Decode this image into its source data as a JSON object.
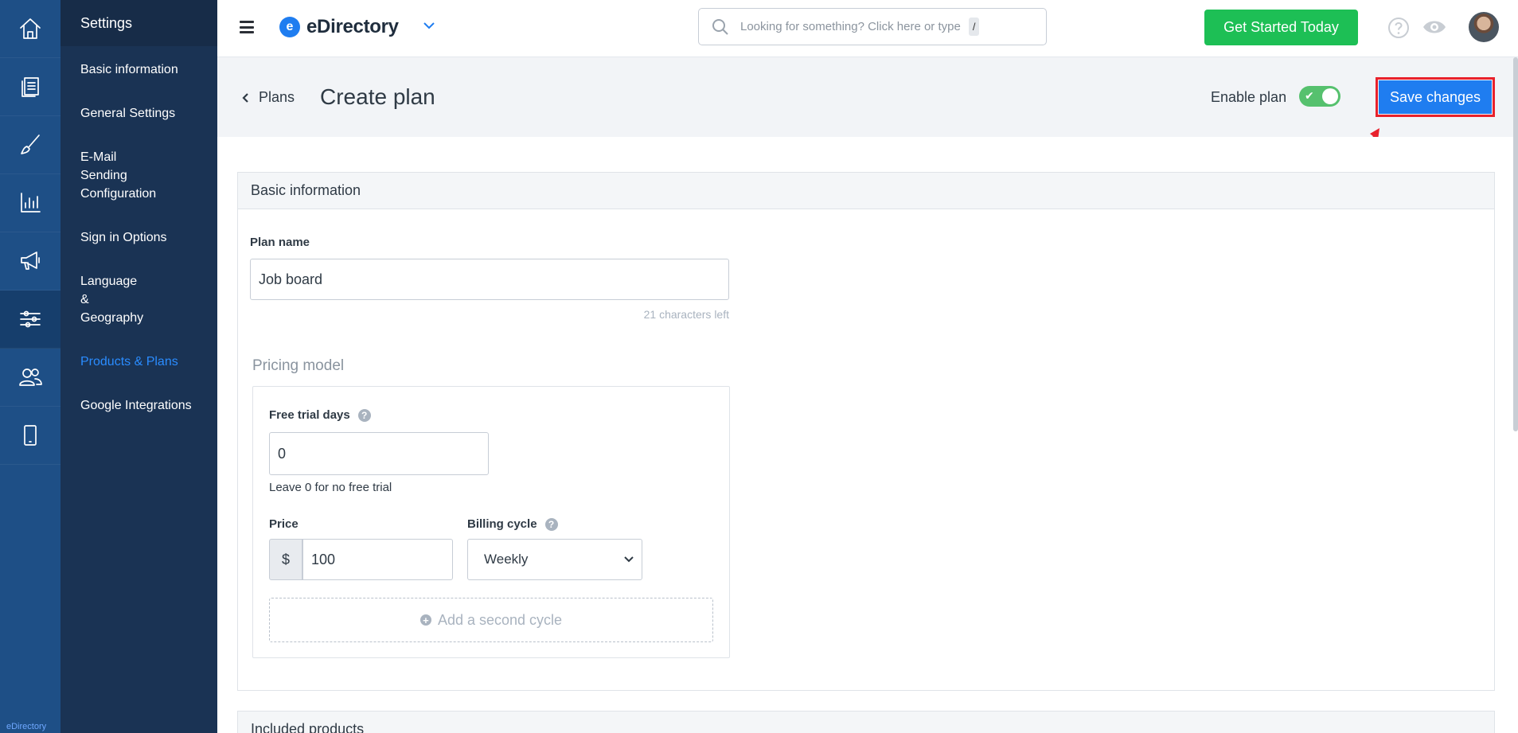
{
  "rail": {
    "brand": "eDirectory",
    "items": [
      {
        "icon": "home-icon"
      },
      {
        "icon": "documents-icon"
      },
      {
        "icon": "brush-icon"
      },
      {
        "icon": "reports-chart-icon"
      },
      {
        "icon": "megaphone-icon"
      },
      {
        "icon": "sliders-icon",
        "active": true
      },
      {
        "icon": "users-icon"
      },
      {
        "icon": "mobile-icon"
      }
    ]
  },
  "sidebar": {
    "title": "Settings",
    "items": [
      {
        "label": "Basic information"
      },
      {
        "label": "General Settings"
      },
      {
        "label": "E-Mail Sending Configuration"
      },
      {
        "label": "Sign in Options"
      },
      {
        "label": "Language & Geography"
      },
      {
        "label": "Products & Plans",
        "active": true
      },
      {
        "label": "Google Integrations"
      }
    ]
  },
  "topbar": {
    "logo_mark": "e",
    "logo_text": "eDirectory",
    "search_placeholder": "Looking for something? Click here or type",
    "search_shortcut": "/",
    "cta_label": "Get Started Today"
  },
  "header": {
    "back_label": "Plans",
    "title": "Create plan",
    "enable_label": "Enable plan",
    "enabled": true,
    "save_label": "Save changes"
  },
  "basic_info": {
    "heading": "Basic information",
    "plan_name_label": "Plan name",
    "plan_name_value": "Job board",
    "chars_left": "21 characters left"
  },
  "pricing": {
    "heading": "Pricing model",
    "trial_label": "Free trial days",
    "trial_value": "0",
    "trial_hint": "Leave 0 for no free trial",
    "price_label": "Price",
    "currency": "$",
    "price_value": "100",
    "billing_label": "Billing cycle",
    "billing_value": "Weekly",
    "add_cycle_label": "Add a second cycle"
  },
  "included": {
    "heading": "Included products"
  },
  "colors": {
    "rail": "#1e4f86",
    "sidebar": "#1a3354",
    "accent": "#1f7df0",
    "cta": "#1dbf55",
    "highlight": "#e8212c"
  }
}
